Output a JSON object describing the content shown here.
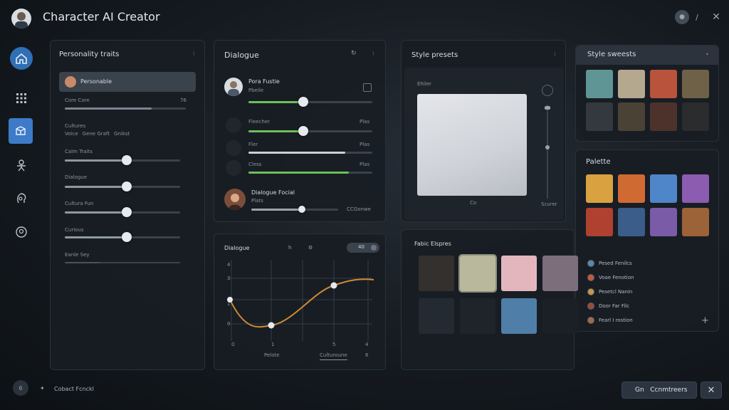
{
  "app": {
    "title": "Character AI Creator"
  },
  "sidebar": {
    "items": [
      {
        "icon": "house-icon",
        "active": false
      },
      {
        "icon": "grid-icon",
        "active": false
      },
      {
        "icon": "box-icon",
        "active": true
      },
      {
        "icon": "figure-icon",
        "active": false
      },
      {
        "icon": "head-icon",
        "active": false
      },
      {
        "icon": "face-icon",
        "active": false
      }
    ],
    "bottom_badge": "6"
  },
  "personality": {
    "title": "Personality traits",
    "selected_item": "Personable",
    "rows": [
      {
        "label": "Core Core",
        "value": "76",
        "level": 0.82
      },
      {
        "label": "Cultures",
        "value": "",
        "level": null
      },
      {
        "label": "Calm Traits",
        "value": "",
        "level": 0.58
      },
      {
        "label": "Dialogue",
        "value": "",
        "level": 0.58
      },
      {
        "label": "Cultura Fun",
        "value": "",
        "level": 0.58
      },
      {
        "label": "Curious",
        "value": "",
        "level": 0.58
      },
      {
        "label": "Eanle Sey",
        "value": "",
        "level": 0.3
      }
    ],
    "options": [
      "Voice",
      "Gene Graft",
      "Gnikst"
    ]
  },
  "dialogue": {
    "title": "Dialogue",
    "persona": {
      "name": "Pora Fustie",
      "sub": "Pbeile"
    },
    "sliders": [
      {
        "label": "Fleecher",
        "value": "Plas",
        "level": 0.5
      },
      {
        "label": "Fler",
        "value": "Plas",
        "level": 0.78
      },
      {
        "label": "Cless",
        "value": "Plas",
        "level": 0.8
      }
    ],
    "footer_persona": {
      "name": "Dialogue Focial",
      "sub": "Plats",
      "value": "CCGonwe",
      "level": 0.6
    }
  },
  "curve": {
    "title": "Dialogue",
    "toggle_value": "40",
    "y_labels": [
      "4",
      "3",
      "1",
      "0"
    ],
    "x_labels": [
      "0",
      "1",
      "5",
      "4"
    ],
    "x_footer": [
      "Pelote",
      "Culturoune",
      "6"
    ]
  },
  "style_presets_preview": {
    "title": "Style presets",
    "preview_label": "Ehiler",
    "caption_left": "Co",
    "caption_right": "Scurer"
  },
  "style_swatches": {
    "title": "Style sweests",
    "colors": [
      "#5f9594",
      "#b4a88f",
      "#b9533b",
      "#6f6148",
      "#34393f",
      "#4b4236",
      "#4d322c",
      "#2a2c2d"
    ]
  },
  "palette": {
    "title": "Palette",
    "colors": [
      "#d9a13f",
      "#d06a33",
      "#4f85c9",
      "#8b5cb0",
      "#b0402f",
      "#3b5d8a",
      "#7a5ba8",
      "#9c6238"
    ],
    "items": [
      {
        "label": "Pesed Fenilcs",
        "color": "#5a8aa8"
      },
      {
        "label": "Voae Fenotion",
        "color": "#c9563b"
      },
      {
        "label": "Pesetcl Nanin",
        "color": "#c5974a"
      },
      {
        "label": "Door Far Filc",
        "color": "#9a4a38"
      },
      {
        "label": "Fearl I rostion",
        "color": "#a36a45"
      }
    ]
  },
  "fabric": {
    "title": "Fabic Elspres",
    "colors": [
      "#33302d",
      "#b9b89c",
      "#e3b6bd",
      "#7d6e7c",
      "#232a31",
      "#1f242a",
      "#4f7ea8",
      "#1b2026"
    ]
  },
  "footer": {
    "status": "Cobact Fcnckl",
    "primary_button": "Gn   Ccnmtreers"
  }
}
